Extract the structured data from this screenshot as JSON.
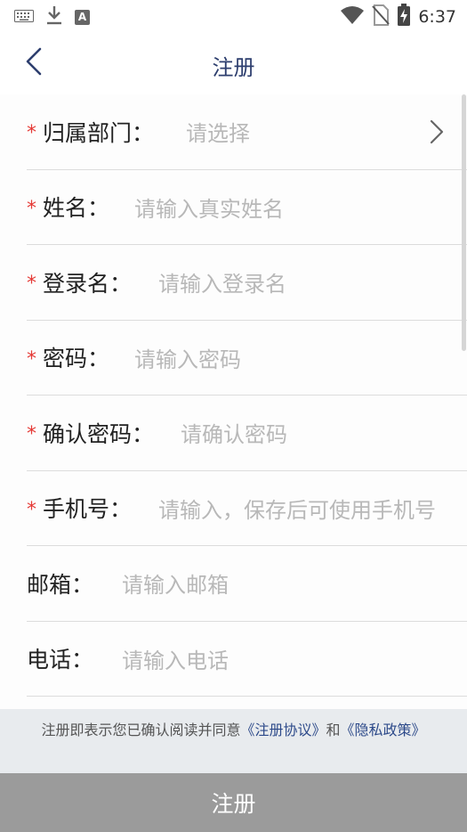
{
  "status_bar": {
    "time": "6:37",
    "icons": [
      "keyboard-icon",
      "download-icon",
      "a-letter-icon",
      "wifi-icon",
      "no-sim-icon",
      "battery-charging-icon"
    ],
    "a_letter": "A"
  },
  "header": {
    "title": "注册",
    "back_icon": "chevron-left-icon"
  },
  "form": {
    "fields": [
      {
        "required": true,
        "label": "归属部门：",
        "placeholder": "请选择",
        "chevron": true
      },
      {
        "required": true,
        "label": "姓名：",
        "placeholder": "请输入真实姓名"
      },
      {
        "required": true,
        "label": "登录名：",
        "placeholder": "请输入登录名"
      },
      {
        "required": true,
        "label": "密码：",
        "placeholder": "请输入密码"
      },
      {
        "required": true,
        "label": "确认密码：",
        "placeholder": "请确认密码"
      },
      {
        "required": true,
        "label": "手机号：",
        "placeholder": "请输入，保存后可使用手机号"
      },
      {
        "required": false,
        "label": "邮箱：",
        "placeholder": "请输入邮箱"
      },
      {
        "required": false,
        "label": "电话：",
        "placeholder": "请输入电话"
      }
    ],
    "required_mark": "*"
  },
  "agreement": {
    "prefix": "注册即表示您已确认阅读并同意",
    "link1": "《注册协议》",
    "connector": "和",
    "link2": "《隐私政策》"
  },
  "submit": {
    "label": "注册"
  },
  "colors": {
    "title": "#2d3e6e",
    "required": "#e53935",
    "placeholder": "#b8b8b8",
    "link": "#2d4a8a",
    "submit_bg": "#9b9b9b",
    "agreement_bg": "#e8ebee"
  }
}
